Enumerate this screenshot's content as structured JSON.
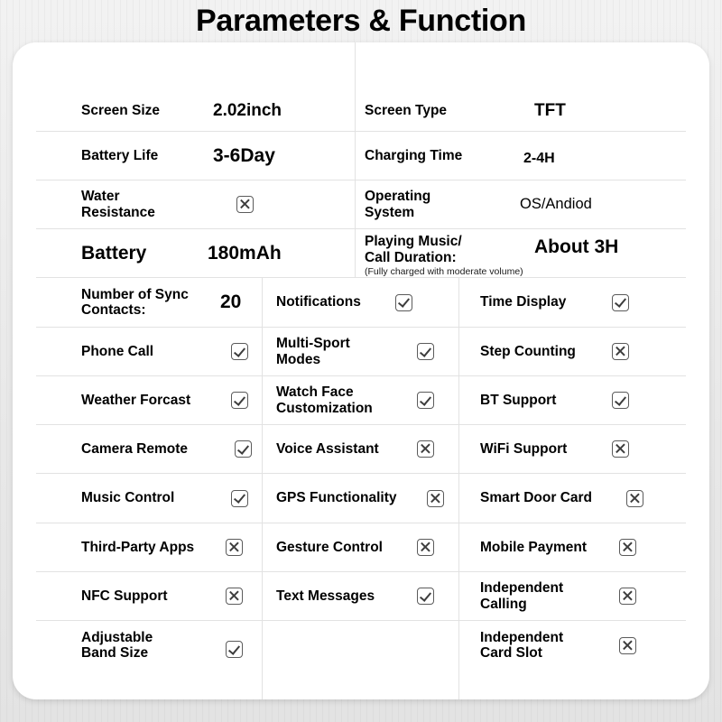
{
  "page": {
    "title": "Parameters & Function",
    "background_color": "#eeeeee",
    "card_color": "#ffffff",
    "text_color": "#000000",
    "rule_color": "#e2e2e2"
  },
  "icons": {
    "checked": "checkbox-checked-icon",
    "unchecked": "checkbox-crossed-icon"
  },
  "specs": {
    "screen_size": {
      "label": "Screen Size",
      "value": "2.02inch"
    },
    "screen_type": {
      "label": "Screen Type",
      "value": "TFT"
    },
    "battery_life": {
      "label": "Battery Life",
      "value": "3-6Day"
    },
    "charging_time": {
      "label": "Charging Time",
      "value": "2-4H"
    },
    "water_resistance": {
      "label": "Water Resistance",
      "value": "X",
      "state": "cross"
    },
    "operating_system": {
      "label": "Operating System",
      "value": "OS/Andiod"
    },
    "battery": {
      "label": "Battery",
      "value": "180mAh"
    },
    "playing_music": {
      "label": "Playing Music/ Call Duration:",
      "note": "(Fully charged with moderate volume)",
      "value": "About 3H"
    },
    "sync_contacts": {
      "label": "Number of Sync Contacts:",
      "value": "20"
    }
  },
  "features": {
    "column_left": [
      {
        "label": "Notifications",
        "state": "check"
      },
      {
        "label": "Phone Call",
        "state": "check"
      },
      {
        "label": "Weather Forcast",
        "state": "check"
      },
      {
        "label": "Camera Remote",
        "state": "check"
      },
      {
        "label": "Music Control",
        "state": "check"
      },
      {
        "label": "Third-Party Apps",
        "state": "cross"
      },
      {
        "label": "NFC Support",
        "state": "cross"
      },
      {
        "label": "Adjustable Band Size",
        "state": "check"
      }
    ],
    "rows": [
      {
        "left": {
          "label": "Number of Sync Contacts:",
          "value": "20"
        },
        "middle": {
          "label": "Notifications",
          "state": "check"
        },
        "right": {
          "label": "Time Display",
          "state": "check"
        }
      },
      {
        "left": {
          "label": "Phone Call",
          "state": "check"
        },
        "middle": {
          "label": "Multi-Sport Modes",
          "state": "check"
        },
        "right": {
          "label": "Step Counting",
          "state": "cross"
        }
      },
      {
        "left": {
          "label": "Weather Forcast",
          "state": "check"
        },
        "middle": {
          "label": "Watch Face Customization",
          "state": "check"
        },
        "right": {
          "label": "BT Support",
          "state": "check"
        }
      },
      {
        "left": {
          "label": "Camera Remote",
          "state": "check"
        },
        "middle": {
          "label": "Voice Assistant",
          "state": "cross"
        },
        "right": {
          "label": "WiFi Support",
          "state": "cross"
        }
      },
      {
        "left": {
          "label": "Music Control",
          "state": "check"
        },
        "middle": {
          "label": "GPS Functionality",
          "state": "cross"
        },
        "right": {
          "label": "Smart Door Card",
          "state": "cross"
        }
      },
      {
        "left": {
          "label": "Third-Party Apps",
          "state": "cross"
        },
        "middle": {
          "label": "Gesture Control",
          "state": "cross"
        },
        "right": {
          "label": "Mobile Payment",
          "state": "cross"
        }
      },
      {
        "left": {
          "label": "NFC Support",
          "state": "cross"
        },
        "middle": {
          "label": "Text Messages",
          "state": "check"
        },
        "right": {
          "label": "Independent Calling",
          "state": "cross"
        }
      },
      {
        "left": {
          "label": "Adjustable Band Size",
          "state": "check"
        },
        "middle": {
          "label": "",
          "state": "none"
        },
        "right": {
          "label": "Independent Card Slot",
          "state": "cross"
        }
      }
    ]
  }
}
